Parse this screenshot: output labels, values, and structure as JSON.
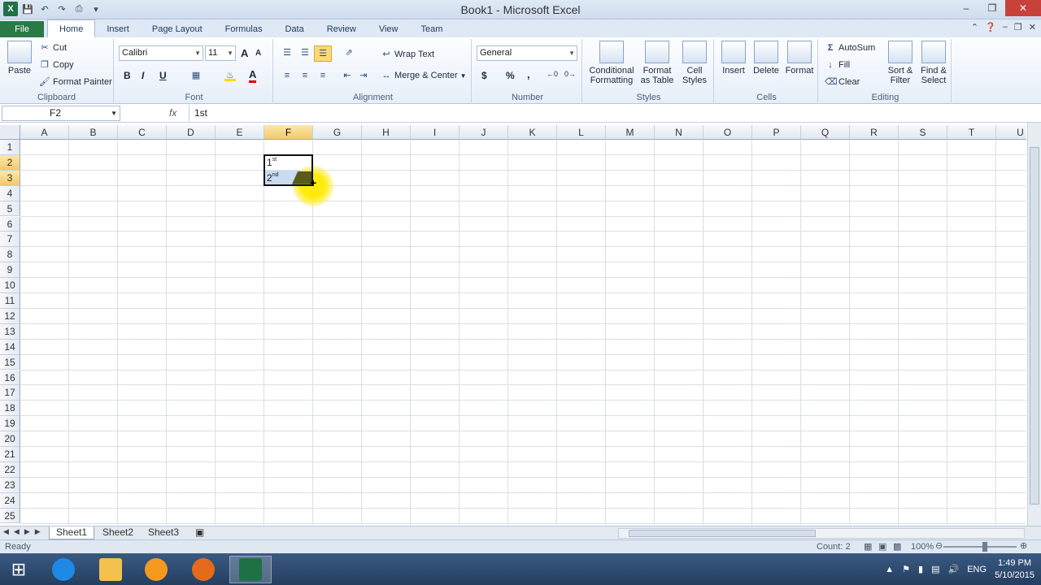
{
  "window": {
    "title": "Book1 - Microsoft Excel"
  },
  "tabs": [
    "File",
    "Home",
    "Insert",
    "Page Layout",
    "Formulas",
    "Data",
    "Review",
    "View",
    "Team"
  ],
  "ribbon": {
    "clipboard": {
      "paste": "Paste",
      "cut": "Cut",
      "copy": "Copy",
      "format_painter": "Format Painter",
      "label": "Clipboard"
    },
    "font": {
      "name": "Calibri",
      "size": "11",
      "label": "Font",
      "bold": "B",
      "italic": "I",
      "underline": "U"
    },
    "alignment": {
      "wrap_text": "Wrap Text",
      "merge_center": "Merge & Center",
      "label": "Alignment"
    },
    "number": {
      "format": "General",
      "label": "Number",
      "currency": "$",
      "percent": "%",
      "comma": ","
    },
    "styles": {
      "conditional": "Conditional Formatting",
      "format_table": "Format as Table",
      "cell_styles": "Cell Styles",
      "label": "Styles"
    },
    "cells": {
      "insert": "Insert",
      "delete": "Delete",
      "format": "Format",
      "label": "Cells"
    },
    "editing": {
      "autosum": "AutoSum",
      "fill": "Fill",
      "clear": "Clear",
      "sort_filter": "Sort & Filter",
      "find_select": "Find & Select",
      "label": "Editing"
    }
  },
  "formula_bar": {
    "name_box": "F2",
    "fx": "fx",
    "content": "1st"
  },
  "grid": {
    "columns": [
      "A",
      "B",
      "C",
      "D",
      "E",
      "F",
      "G",
      "H",
      "I",
      "J",
      "K",
      "L",
      "M",
      "N",
      "O",
      "P",
      "Q",
      "R",
      "S",
      "T",
      "U"
    ],
    "rows": [
      "1",
      "2",
      "3",
      "4",
      "5",
      "6",
      "7",
      "8",
      "9",
      "10",
      "11",
      "12",
      "13",
      "14",
      "15",
      "16",
      "17",
      "18",
      "19",
      "20",
      "21",
      "22",
      "23",
      "24",
      "25"
    ],
    "selected_column": "F",
    "selected_rows": [
      "2",
      "3"
    ],
    "cells": {
      "F2": {
        "base": "1",
        "sup": "st"
      },
      "F3": {
        "base": "2",
        "sup": "nd"
      }
    }
  },
  "sheets": [
    "Sheet1",
    "Sheet2",
    "Sheet3"
  ],
  "active_sheet": "Sheet1",
  "status": {
    "ready": "Ready",
    "count": "Count: 2",
    "zoom": "100%"
  },
  "taskbar": {
    "lang": "ENG",
    "time": "1:49 PM",
    "date": "5/10/2015"
  }
}
